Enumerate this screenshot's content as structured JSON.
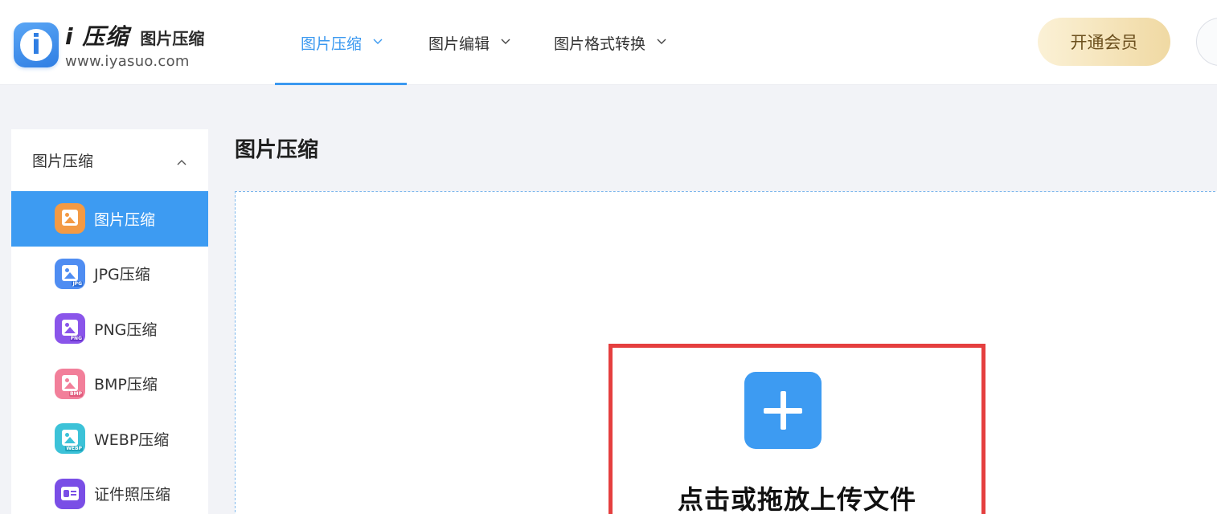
{
  "header": {
    "logo_brand": "i 压缩",
    "logo_subtitle": "图片压缩",
    "logo_url": "www.iyasuo.com",
    "nav": [
      {
        "label": "图片压缩",
        "active": true
      },
      {
        "label": "图片编辑",
        "active": false
      },
      {
        "label": "图片格式转换",
        "active": false
      }
    ],
    "vip_label": "开通会员"
  },
  "sidebar": {
    "group_label": "图片压缩",
    "items": [
      {
        "label": "图片压缩",
        "icon": "image-compress-icon",
        "active": true
      },
      {
        "label": "JPG压缩",
        "icon": "jpg-icon",
        "tag": "JPG"
      },
      {
        "label": "PNG压缩",
        "icon": "png-icon",
        "tag": "PNG"
      },
      {
        "label": "BMP压缩",
        "icon": "bmp-icon",
        "tag": "BMP"
      },
      {
        "label": "WEBP压缩",
        "icon": "webp-icon",
        "tag": "WEBP"
      },
      {
        "label": "证件照压缩",
        "icon": "id-card-icon"
      }
    ]
  },
  "main": {
    "title": "图片压缩",
    "upload_label": "点击或拖放上传文件"
  },
  "colors": {
    "accent": "#3d9bf2",
    "highlight_border": "#e53f3f",
    "vip_gradient_start": "#fbf1d6",
    "vip_gradient_end": "#f0d9a3"
  }
}
